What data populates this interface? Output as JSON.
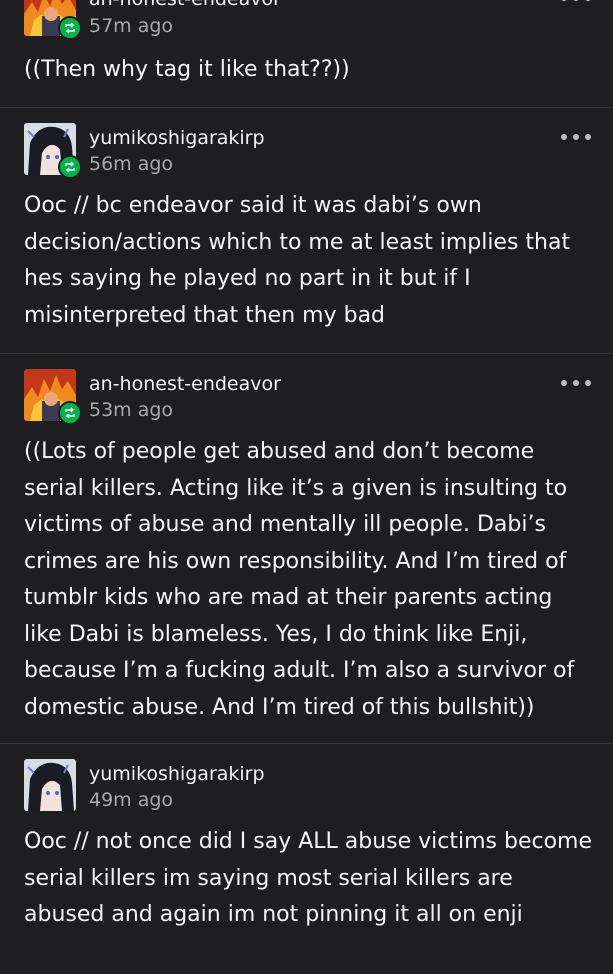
{
  "posts": [
    {
      "username": "an-honest-endeavor",
      "time": "57m ago",
      "body": "((Then why tag it like that??))",
      "avatar": "endeavor-flame-avatar",
      "has_more_menu": true
    },
    {
      "username": "yumikoshigarakirp",
      "time": "56m ago",
      "body": "Ooc // bc endeavor said it was dabi’s own decision/actions which to me at least implies that hes saying he played no part in it but if I misinterpreted that then my bad",
      "avatar": "anime-girl-avatar",
      "has_more_menu": true
    },
    {
      "username": "an-honest-endeavor",
      "time": "53m ago",
      "body": "((Lots of people get abused and don’t become serial killers. Acting like it’s a given is insulting to victims of abuse and mentally ill people. Dabi’s crimes are his own responsibility. And I’m tired of tumblr kids who are mad at their parents acting like Dabi is blameless. Yes, I do think like Enji, because I’m a fucking adult. I’m also a survivor of domestic abuse. And I’m tired of this bullshit))",
      "avatar": "endeavor-flame-avatar",
      "has_more_menu": true
    },
    {
      "username": "yumikoshigarakirp",
      "time": "49m ago",
      "body": "Ooc // not once did I say ALL abuse victims become serial killers im saying most serial killers are abused and again im not pinning it all on enji",
      "avatar": "anime-girl-avatar",
      "has_more_menu": false
    }
  ],
  "colors": {
    "background": "#1e1e20",
    "divider": "#3a3a3d",
    "reblog_badge": "#00b34a",
    "muted_text": "#a8a8ab"
  }
}
